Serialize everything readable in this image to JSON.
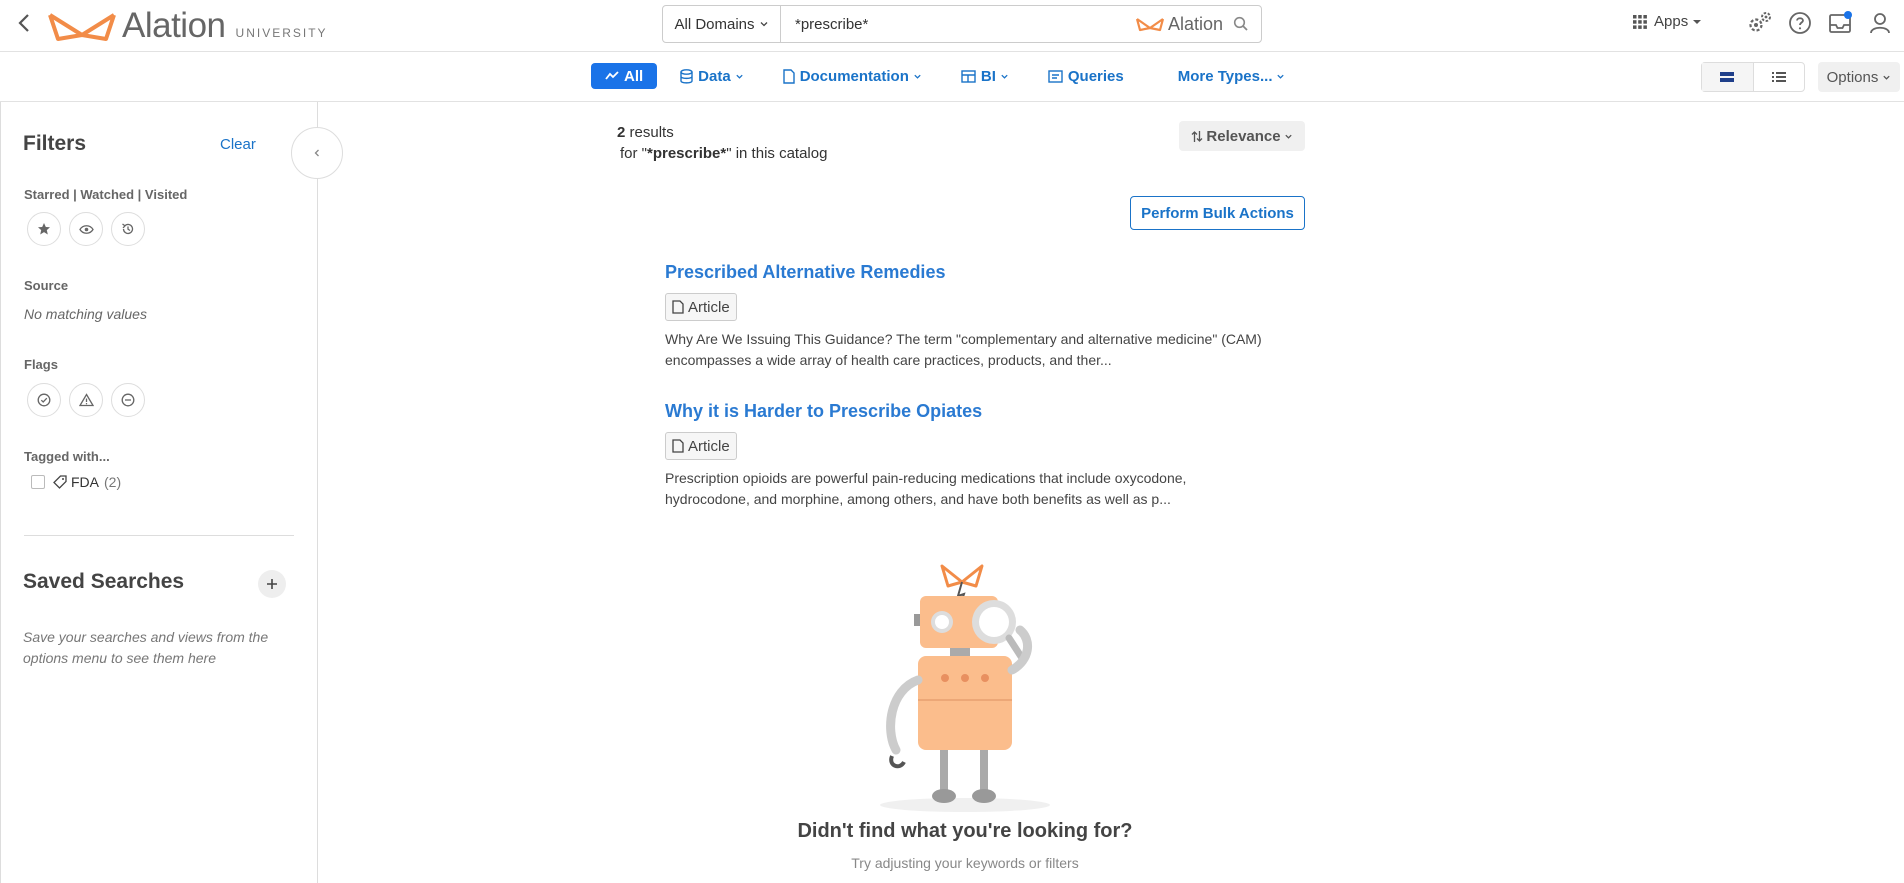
{
  "header": {
    "logo_text": "Alation",
    "logo_sub": "UNIVERSITY",
    "domain_select": "All Domains",
    "search_value": "*prescribe*",
    "search_brand": "Alation",
    "apps_label": "Apps"
  },
  "typebar": {
    "types": [
      {
        "label": "All"
      },
      {
        "label": "Data"
      },
      {
        "label": "Documentation"
      },
      {
        "label": "BI"
      },
      {
        "label": "Queries"
      },
      {
        "label": "More Types..."
      }
    ],
    "options_label": "Options"
  },
  "sidebar": {
    "filters_title": "Filters",
    "clear_label": "Clear",
    "starred_label": "Starred | Watched | Visited",
    "source_label": "Source",
    "source_empty": "No matching values",
    "flags_label": "Flags",
    "tagged_label": "Tagged with...",
    "tags": [
      {
        "name": "FDA",
        "count": "(2)"
      }
    ],
    "saved_title": "Saved Searches",
    "saved_hint": "Save your searches and views from the options menu to see them here"
  },
  "results": {
    "count": "2",
    "count_label": "results",
    "for_prefix": "for \"",
    "query": "*prescribe*",
    "for_suffix": "\" in this catalog",
    "sort_label": "Relevance",
    "bulk_label": "Perform Bulk Actions",
    "items": [
      {
        "title": "Prescribed Alternative Remedies",
        "type": "Article",
        "snippet": "Why Are We Issuing This Guidance? The term \"complementary and alternative medicine\" (CAM) encompasses a wide array of health care practices, products, and ther..."
      },
      {
        "title": "Why it is Harder to Prescribe Opiates",
        "type": "Article",
        "snippet": "Prescription opioids are powerful pain-reducing medications that include oxycodone, hydrocodone, and morphine, among others, and have both benefits as well as p..."
      }
    ],
    "not_found_title": "Didn't find what you're looking for?",
    "not_found_sub": "Try adjusting your keywords or filters"
  },
  "colors": {
    "brand_orange": "#f28c48",
    "accent_blue": "#1a73e8"
  }
}
